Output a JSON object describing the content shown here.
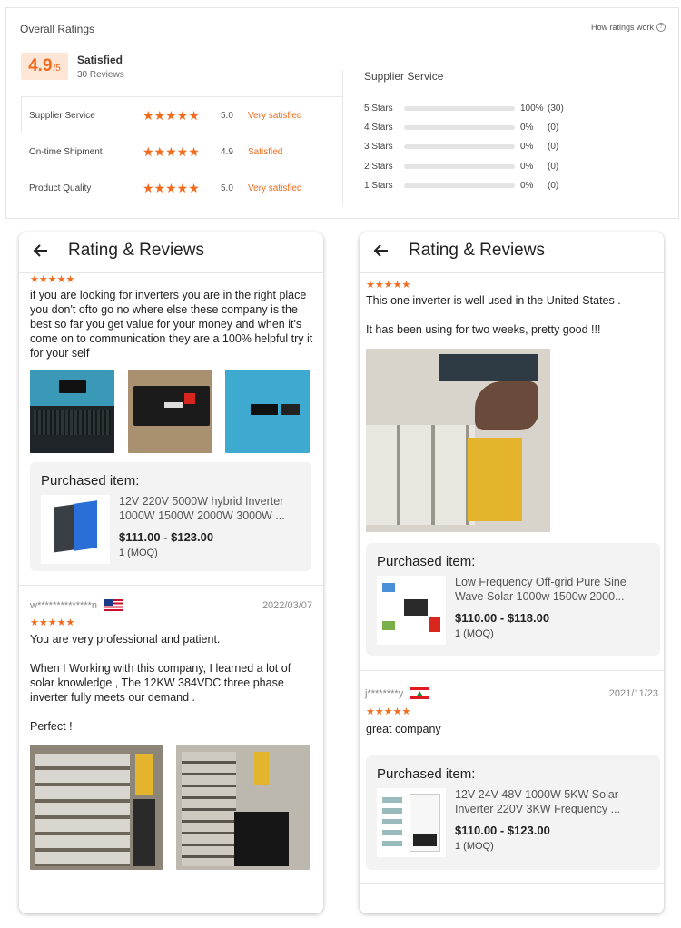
{
  "overall": {
    "title": "Overall Ratings",
    "how_link": "How ratings work",
    "help_glyph": "?",
    "score": "4.9",
    "score_max": "/5",
    "satisfaction": "Satisfied",
    "reviews": "30 Reviews",
    "categories": [
      {
        "name": "Supplier Service",
        "stars": "★★★★★",
        "score": "5.0",
        "label": "Very satisfied"
      },
      {
        "name": "On-time Shipment",
        "stars": "★★★★★",
        "score": "4.9",
        "label": "Satisfied"
      },
      {
        "name": "Product Quality",
        "stars": "★★★★★",
        "score": "5.0",
        "label": "Very satisfied"
      }
    ],
    "supplier_service": {
      "title": "Supplier Service",
      "bars": [
        {
          "label": "5 Stars",
          "fraction": 1.0,
          "pct": "100%",
          "count": "(30)"
        },
        {
          "label": "4 Stars",
          "fraction": 0.0,
          "pct": "0%",
          "count": "(0)"
        },
        {
          "label": "3 Stars",
          "fraction": 0.0,
          "pct": "0%",
          "count": "(0)"
        },
        {
          "label": "2 Stars",
          "fraction": 0.0,
          "pct": "0%",
          "count": "(0)"
        },
        {
          "label": "1 Stars",
          "fraction": 0.0,
          "pct": "0%",
          "count": "(0)"
        }
      ]
    }
  },
  "left_phone": {
    "title": "Rating & Reviews",
    "review1": {
      "stars": "★★★★★",
      "text": "if you are looking for inverters you are in the right place you don't ofto go no where else  these company is the best so far you get value for your money and when it's come on to communication they are a 100% helpful try it for your self"
    },
    "purchased1": {
      "label": "Purchased item:",
      "name": "12V 220V 5000W hybrid Inverter 1000W 1500W 2000W 3000W ...",
      "price": "$111.00 - $123.00",
      "moq": "1 (MOQ)"
    },
    "review2": {
      "reviewer": "w**************n",
      "date": "2022/03/07",
      "stars": "★★★★★",
      "text": "You are very professional and patient.\n\nWhen  I Working with this company, I learned a lot of solar knowledge ,  The 12KW 384VDC three phase inverter fully meets our demand .\n\nPerfect !"
    }
  },
  "right_phone": {
    "title": "Rating & Reviews",
    "review1": {
      "stars": "★★★★★",
      "text": "This one inverter is well used in the United States .\n\nIt has been using  for two weeks, pretty good !!!"
    },
    "purchased1": {
      "label": "Purchased item:",
      "name": "Low Frequency Off-grid Pure Sine Wave Solar 1000w 1500w 2000...",
      "price": "$110.00 - $118.00",
      "moq": "1 (MOQ)"
    },
    "review2": {
      "reviewer": "j********y",
      "date": "2021/11/23",
      "stars": "★★★★★",
      "text": "great company"
    },
    "purchased2": {
      "label": "Purchased item:",
      "name": "12V 24V 48V 1000W 5KW Solar Inverter 220V 3KW Frequency ...",
      "price": "$110.00 - $123.00",
      "moq": "1 (MOQ)"
    }
  },
  "colors": {
    "accent": "#f26b1d",
    "score_bg": "#fde6d6",
    "card_bg": "#f3f3f3"
  }
}
